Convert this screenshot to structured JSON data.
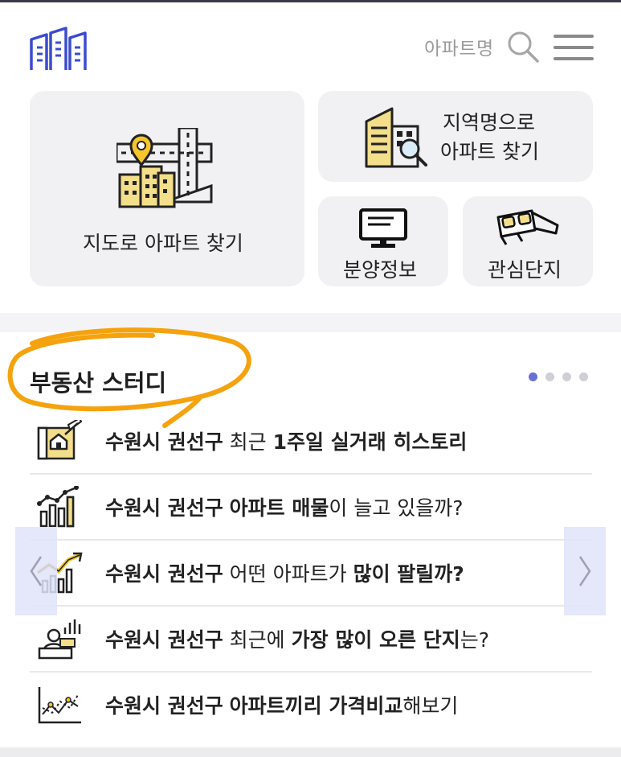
{
  "header": {
    "search_label": "아파트명",
    "logo_icon": "buildings-logo-icon",
    "search_icon": "search-icon",
    "menu_icon": "hamburger-menu-icon"
  },
  "tiles": {
    "map": {
      "label": "지도로 아파트 찾기",
      "icon": "map-building-icon"
    },
    "region": {
      "label_line1": "지역명으로",
      "label_line2": "아파트 찾기",
      "icon": "building-search-icon"
    },
    "sale": {
      "label": "분양정보",
      "icon": "monitor-icon"
    },
    "favorite": {
      "label": "관심단지",
      "icon": "glasses-icon"
    }
  },
  "study": {
    "title": "부동산 스터디",
    "pager": {
      "total": 4,
      "active": 1
    },
    "items": [
      {
        "icon": "house-blueprint-icon",
        "parts": [
          {
            "t": "수원시 권선구",
            "b": true
          },
          {
            "t": " 최근 ",
            "b": false
          },
          {
            "t": "1주일 실거래 히스토리",
            "b": true
          }
        ]
      },
      {
        "icon": "bar-chart-icon",
        "parts": [
          {
            "t": "수원시 권선구",
            "b": true
          },
          {
            "t": " ",
            "b": false
          },
          {
            "t": "아파트 매물",
            "b": true
          },
          {
            "t": "이 늘고 있을까?",
            "b": false
          }
        ]
      },
      {
        "icon": "trend-chart-icon",
        "parts": [
          {
            "t": "수원시 권선구",
            "b": true
          },
          {
            "t": " 어떤 아파트가 ",
            "b": false
          },
          {
            "t": "많이 팔릴까?",
            "b": true
          }
        ]
      },
      {
        "icon": "presenter-chart-icon",
        "parts": [
          {
            "t": "수원시 권선구",
            "b": true
          },
          {
            "t": " 최근에 ",
            "b": false
          },
          {
            "t": "가장 많이 오른 단지",
            "b": true
          },
          {
            "t": "는?",
            "b": false
          }
        ]
      },
      {
        "icon": "price-compare-icon",
        "parts": [
          {
            "t": "수원시 권선구",
            "b": true
          },
          {
            "t": " ",
            "b": false
          },
          {
            "t": "아파트끼리 가격비교",
            "b": true
          },
          {
            "t": "해보기",
            "b": false
          }
        ]
      }
    ]
  },
  "nav": {
    "prev_icon": "chevron-left-icon",
    "next_icon": "chevron-right-icon"
  },
  "colors": {
    "accent": "#6a6fd6",
    "logo": "#3b4bd0",
    "annotation": "#f4a20e",
    "tile_bg": "#f1f1f3"
  }
}
